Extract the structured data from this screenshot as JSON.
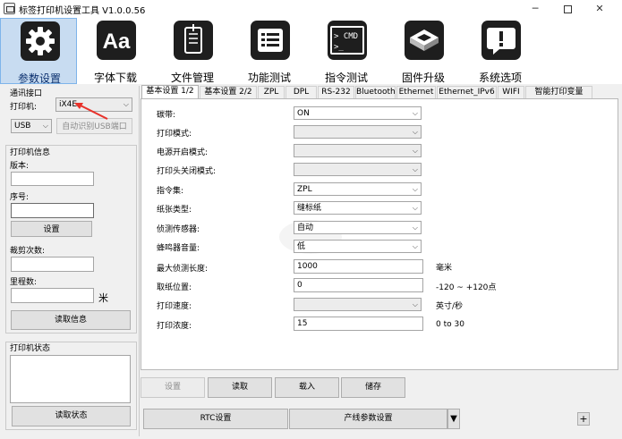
{
  "window": {
    "title": "标签打印机设置工具 V1.0.0.56",
    "min": "─",
    "close": "✕"
  },
  "toolbar": [
    {
      "label": "参数设置",
      "icon": "gear-icon"
    },
    {
      "label": "字体下载",
      "icon": "font-aa-icon"
    },
    {
      "label": "文件管理",
      "icon": "document-icon"
    },
    {
      "label": "功能测试",
      "icon": "list-icon"
    },
    {
      "label": "指令测试",
      "icon": "command-prompt-icon"
    },
    {
      "label": "固件升级",
      "icon": "chip-icon"
    },
    {
      "label": "系统选项",
      "icon": "info-message-icon"
    }
  ],
  "comm": {
    "title": "通讯接口",
    "printer_label": "打印机:",
    "printer_value": "iX4E",
    "port_value": "USB",
    "auto_button": "自动识别USB端口"
  },
  "printer_info": {
    "title": "打印机信息",
    "version_label": "版本:",
    "serial_label": "序号:",
    "set_button": "设置",
    "cut_count_label": "裁剪次数:",
    "mileage_label": "里程数:",
    "mileage_unit": "米",
    "read_button": "读取信息"
  },
  "printer_status": {
    "title": "打印机状态",
    "read_button": "读取状态"
  },
  "tabs": [
    "基本设置 1/2",
    "基本设置 2/2",
    "ZPL",
    "DPL",
    "RS-232",
    "Bluetooth",
    "Ethernet",
    "Ethernet_IPv6",
    "WIFI",
    "智能打印变量"
  ],
  "settings": [
    {
      "label": "碳带:",
      "value": "ON",
      "type": "select"
    },
    {
      "label": "打印模式:",
      "value": "",
      "type": "select"
    },
    {
      "label": "电源开启模式:",
      "value": "",
      "type": "select"
    },
    {
      "label": "打印头关闭模式:",
      "value": "",
      "type": "select"
    },
    {
      "label": "指令集:",
      "value": "ZPL",
      "type": "select"
    },
    {
      "label": "纸张类型:",
      "value": "缝标纸",
      "type": "select"
    },
    {
      "label": "侦测传感器:",
      "value": "自动",
      "type": "select"
    },
    {
      "label": "蜂鸣器音量:",
      "value": "低",
      "type": "select"
    },
    {
      "label": "最大侦测长度:",
      "value": "1000",
      "type": "input",
      "unit": "毫米"
    },
    {
      "label": "取纸位置:",
      "value": "0",
      "type": "input",
      "unit": "-120 ~ +120点"
    },
    {
      "label": "打印速度:",
      "value": "",
      "type": "select",
      "unit": "英寸/秒"
    },
    {
      "label": "打印浓度:",
      "value": "15",
      "type": "input",
      "unit": "0 to 30"
    }
  ],
  "actions": {
    "set": "设置",
    "read": "读取",
    "load": "载入",
    "save": "储存"
  },
  "bottom": {
    "rtc": "RTC设置",
    "production": "产线参数设置",
    "plus": "+"
  },
  "colors": {
    "active_tool_bg": "#c8dcf1",
    "annotation_arrow": "#e8312a"
  }
}
